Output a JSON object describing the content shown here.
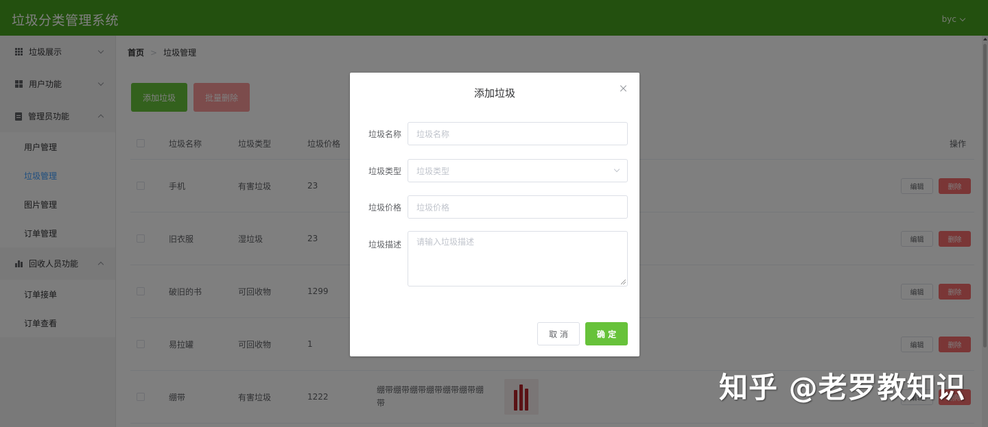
{
  "app": {
    "title": "垃圾分类管理系统",
    "user": "byc"
  },
  "sidebar": {
    "groups": [
      {
        "label": "垃圾展示",
        "icon": "grid-icon",
        "expanded": false,
        "items": []
      },
      {
        "label": "用户功能",
        "icon": "apps-icon",
        "expanded": false,
        "items": []
      },
      {
        "label": "管理员功能",
        "icon": "clipboard-icon",
        "expanded": true,
        "items": [
          "用户管理",
          "垃圾管理",
          "图片管理",
          "订单管理"
        ]
      },
      {
        "label": "回收人员功能",
        "icon": "bar-chart-icon",
        "expanded": true,
        "items": [
          "订单接单",
          "订单查看"
        ]
      }
    ],
    "active_item": "垃圾管理"
  },
  "breadcrumb": [
    "首页",
    "垃圾管理"
  ],
  "toolbar": {
    "add_label": "添加垃圾",
    "batch_delete_label": "批量删除"
  },
  "table": {
    "headers": {
      "name": "垃圾名称",
      "type": "垃圾类型",
      "price": "垃圾价格",
      "op": "操作"
    },
    "rows": [
      {
        "name": "手机",
        "type": "有害垃圾",
        "price": "23",
        "desc": ""
      },
      {
        "name": "旧衣服",
        "type": "湿垃圾",
        "price": "23",
        "desc": ""
      },
      {
        "name": "破旧的书",
        "type": "可回收物",
        "price": "1299",
        "desc": ""
      },
      {
        "name": "易拉罐",
        "type": "可回收物",
        "price": "1",
        "desc": ""
      },
      {
        "name": "绷带",
        "type": "有害垃圾",
        "price": "1222",
        "desc": "绷带绷带绷带绷带绷带绷带绷带"
      }
    ],
    "edit_label": "编辑",
    "delete_label": "删除"
  },
  "dialog": {
    "title": "添加垃圾",
    "fields": {
      "name": {
        "label": "垃圾名称",
        "placeholder": "垃圾名称"
      },
      "type": {
        "label": "垃圾类型",
        "placeholder": "垃圾类型"
      },
      "price": {
        "label": "垃圾价格",
        "placeholder": "垃圾价格"
      },
      "desc": {
        "label": "垃圾描述",
        "placeholder": "请输入垃圾描述"
      }
    },
    "cancel_label": "取 消",
    "confirm_label": "确 定"
  },
  "watermark": "知乎 @老罗教知识",
  "colors": {
    "header": "#47a11f",
    "primary_green": "#67c23a",
    "danger": "#f56c6c",
    "active_link": "#409eff"
  }
}
